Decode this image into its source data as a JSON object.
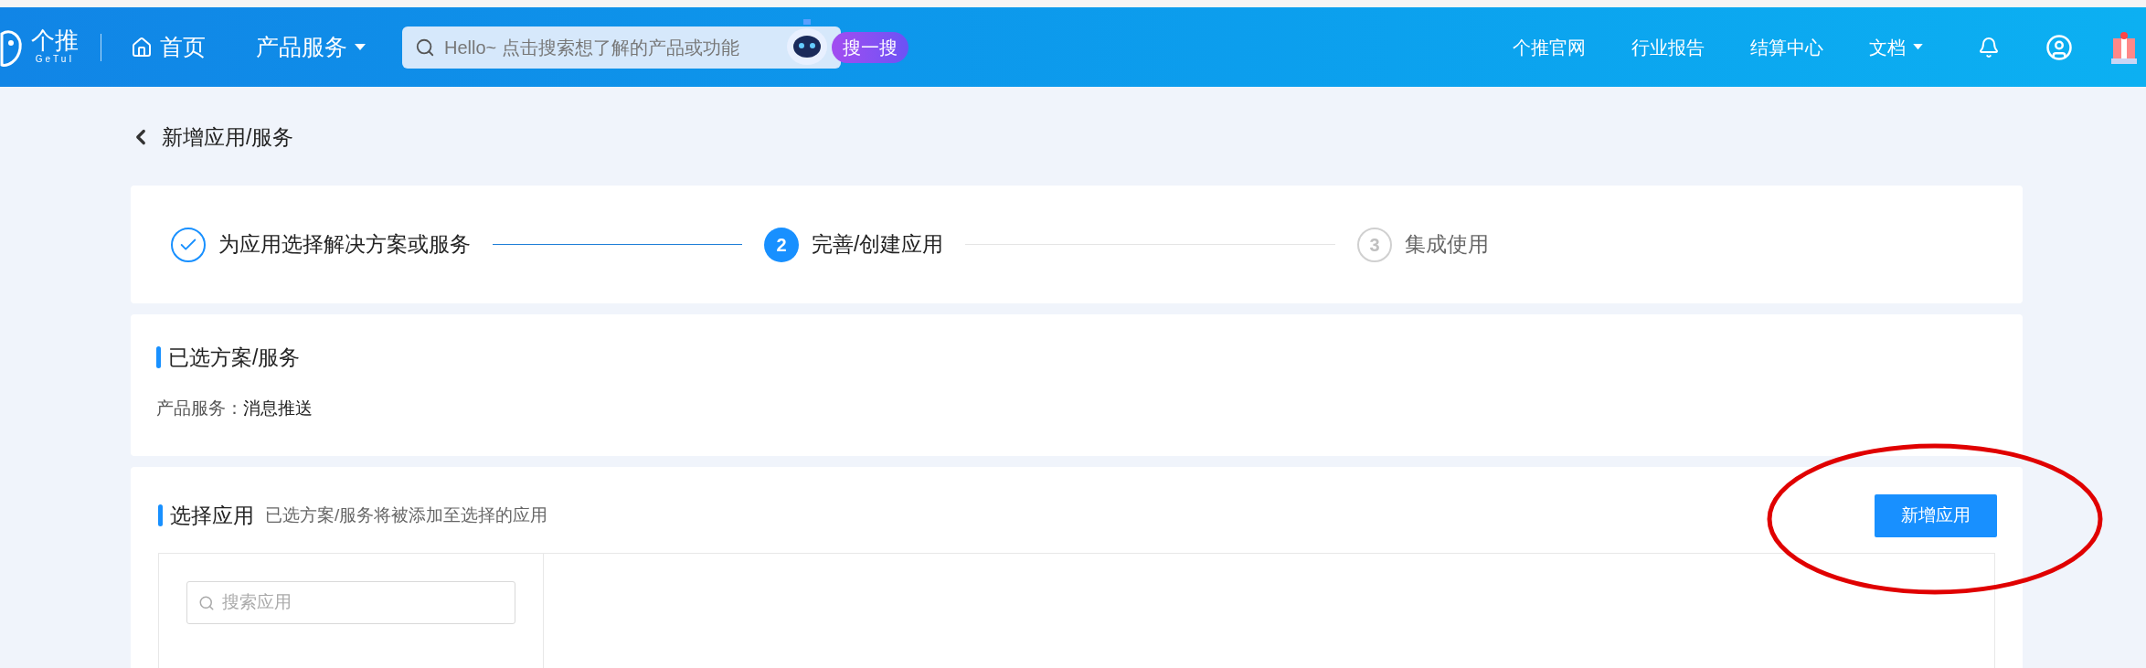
{
  "header": {
    "logo_text": "个推",
    "logo_subtext": "GeTuI",
    "nav": [
      {
        "label": "首页",
        "kind": "home"
      },
      {
        "label": "产品服务",
        "kind": "dropdown"
      }
    ],
    "search": {
      "placeholder": "Hello~ 点击搜索想了解的产品或功能",
      "button": "搜一搜"
    },
    "links": [
      {
        "label": "个推官网",
        "kind": "link"
      },
      {
        "label": "行业报告",
        "kind": "link"
      },
      {
        "label": "结算中心",
        "kind": "link"
      },
      {
        "label": "文档",
        "kind": "dropdown"
      }
    ]
  },
  "page_title": "新增应用/服务",
  "steps": [
    {
      "label": "为应用选择解决方案或服务",
      "kind": "done"
    },
    {
      "number": "2",
      "label": "完善/创建应用",
      "kind": "current"
    },
    {
      "number": "3",
      "label": "集成使用",
      "kind": "pending"
    }
  ],
  "selected_section": {
    "title": "已选方案/服务",
    "field_label": "产品服务：",
    "field_value": "消息推送"
  },
  "choose_section": {
    "title": "选择应用",
    "hint": "已选方案/服务将被添加至选择的应用",
    "button": "新增应用",
    "search_placeholder": "搜索应用"
  }
}
